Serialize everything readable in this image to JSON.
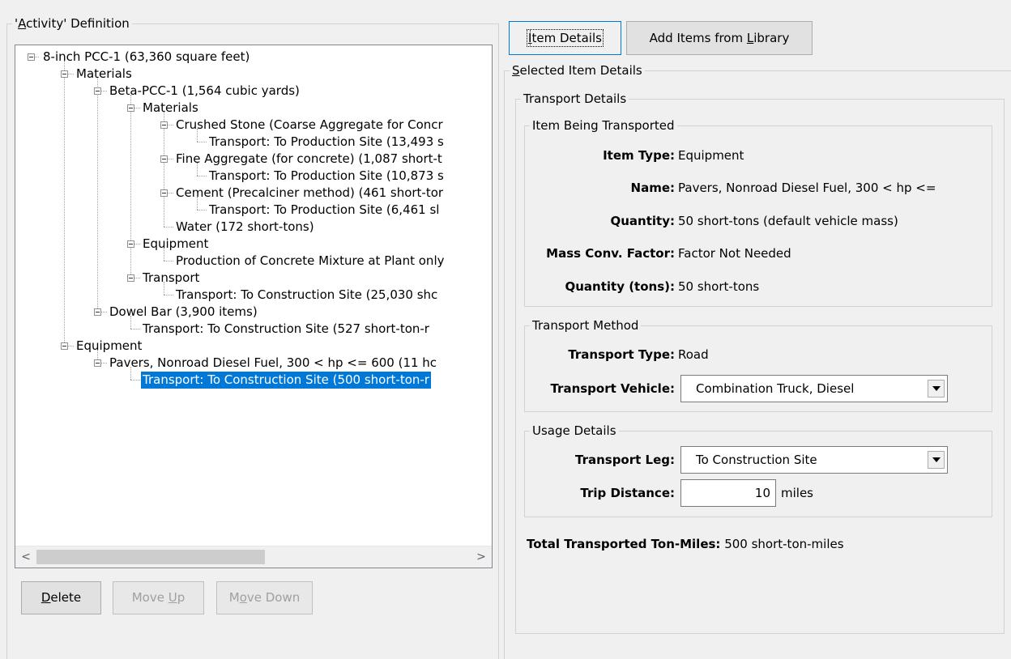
{
  "left": {
    "group_title_pre": "'",
    "group_title_hot": "A",
    "group_title_post": "ctivity' Definition",
    "tree": [
      {
        "label": "8-inch PCC-1 (63,360 square feet)"
      },
      {
        "label": "Materials"
      },
      {
        "label": "Beta-PCC-1 (1,564 cubic yards)"
      },
      {
        "label": "Materials"
      },
      {
        "label": "Crushed Stone (Coarse Aggregate for Concr"
      },
      {
        "label": "Transport: To Production Site (13,493 s"
      },
      {
        "label": "Fine Aggregate (for concrete) (1,087 short-t"
      },
      {
        "label": "Transport: To Production Site (10,873 s"
      },
      {
        "label": "Cement (Precalciner method) (461 short-tor"
      },
      {
        "label": "Transport: To Production Site (6,461 sl"
      },
      {
        "label": "Water (172 short-tons)"
      },
      {
        "label": "Equipment"
      },
      {
        "label": "Production of Concrete Mixture at Plant only"
      },
      {
        "label": "Transport"
      },
      {
        "label": "Transport: To Construction Site (25,030 shc"
      },
      {
        "label": "Dowel Bar (3,900 items)"
      },
      {
        "label": "Transport: To Construction Site (527 short-ton-r"
      },
      {
        "label": "Equipment"
      },
      {
        "label": "Pavers, Nonroad Diesel Fuel, 300 < hp <= 600 (11 hc"
      },
      {
        "label": "Transport: To Construction Site (500 short-ton-r"
      }
    ],
    "buttons": {
      "delete_hot": "D",
      "delete_rest": "elete",
      "move_up_pre": "Move ",
      "move_up_hot": "U",
      "move_up_post": "p",
      "move_down_pre": "M",
      "move_down_hot": "o",
      "move_down_post": "ve Down"
    },
    "scroll": {
      "left": "<",
      "right": ">"
    }
  },
  "right": {
    "tabs": {
      "item_details_hot": "I",
      "item_details_rest": "tem Details",
      "library_pre": "Add Items from ",
      "library_hot": "L",
      "library_post": "ibrary"
    },
    "selected_hot": "S",
    "selected_rest": "elected Item Details",
    "transport_details": "Transport Details",
    "item_being": {
      "title": "Item Being Transported",
      "item_type_label": "Item Type:",
      "item_type_value": "Equipment",
      "name_label": "Name:",
      "name_value": "Pavers, Nonroad Diesel Fuel, 300 < hp <=",
      "quantity_label": "Quantity:",
      "quantity_value": "50 short-tons (default vehicle mass)",
      "mass_label": "Mass Conv. Factor:",
      "mass_value": "Factor Not Needed",
      "qty_tons_label": "Quantity (tons):",
      "qty_tons_value": "50 short-tons"
    },
    "method": {
      "title": "Transport Method",
      "type_label": "Transport Type:",
      "type_value": "Road",
      "vehicle_label": "Transport Vehicle:",
      "vehicle_value": "Combination Truck, Diesel"
    },
    "usage": {
      "title": "Usage Details",
      "leg_label": "Transport Leg:",
      "leg_value": "To Construction Site",
      "distance_label": "Trip Distance:",
      "distance_value": "10",
      "distance_unit": "miles"
    },
    "total_label": "Total Transported Ton-Miles:",
    "total_value": "500 short-ton-miles"
  },
  "colors": {
    "selection": "#0078d7",
    "focus_border": "#0078d7"
  }
}
